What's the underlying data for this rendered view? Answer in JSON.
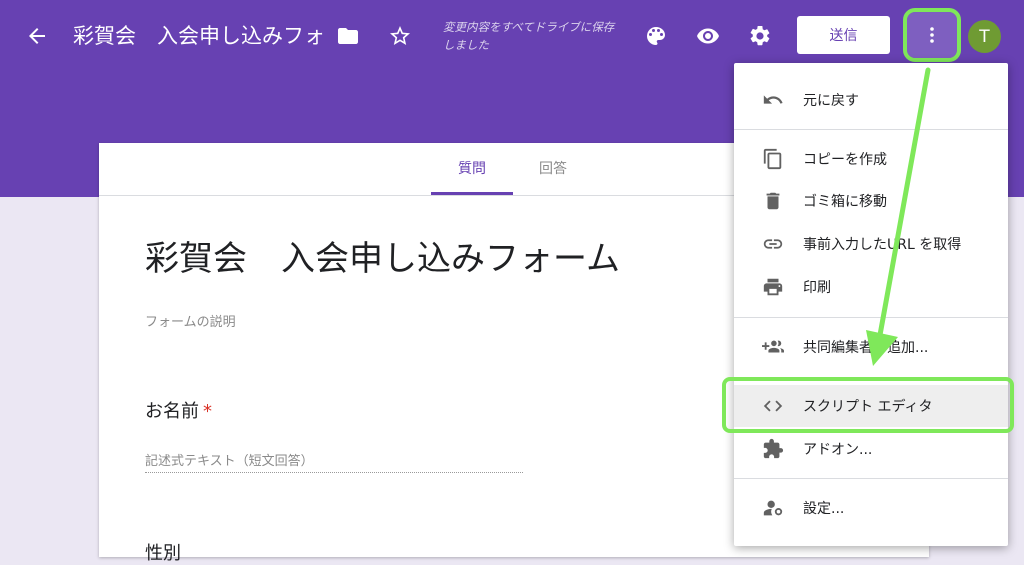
{
  "header": {
    "title": "彩賀会　入会申し込みフォーム",
    "saved_status": "変更内容をすべてドライブに保存しました",
    "send_label": "送信",
    "avatar_initial": "T",
    "icons": [
      "back-arrow-icon",
      "folder-icon",
      "star-icon",
      "palette-icon",
      "preview-eye-icon",
      "settings-gear-icon",
      "more-vert-icon"
    ]
  },
  "tabs": [
    {
      "label": "質問",
      "active": true
    },
    {
      "label": "回答",
      "active": false
    }
  ],
  "form": {
    "title": "彩賀会　入会申し込みフォーム",
    "description_placeholder": "フォームの説明",
    "questions": [
      {
        "label": "お名前",
        "required_mark": "*",
        "answer_placeholder": "記述式テキスト（短文回答）"
      },
      {
        "label": "性別"
      }
    ]
  },
  "menu": {
    "items": [
      {
        "label": "元に戻す",
        "icon": "undo-icon"
      },
      {
        "label": "コピーを作成",
        "icon": "copy-icon"
      },
      {
        "label": "ゴミ箱に移動",
        "icon": "trash-icon"
      },
      {
        "label": "事前入力したURL を取得",
        "icon": "link-icon"
      },
      {
        "label": "印刷",
        "icon": "print-icon"
      },
      {
        "label": "共同編集者を追加...",
        "icon": "add-people-icon"
      },
      {
        "label": "スクリプト エディタ",
        "icon": "code-icon"
      },
      {
        "label": "アドオン...",
        "icon": "puzzle-icon"
      },
      {
        "label": "設定...",
        "icon": "person-settings-icon"
      }
    ]
  },
  "colors": {
    "header_bg": "#6741b2",
    "accent": "#6741b2",
    "annotation_green": "#7fe85a",
    "page_bg": "#ebe7f3"
  }
}
